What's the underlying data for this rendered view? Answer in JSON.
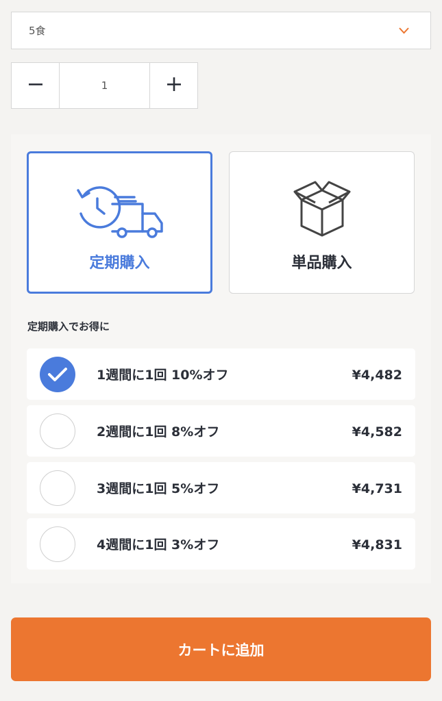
{
  "meal_select": {
    "value": "5食",
    "icon": "chevron-down-icon",
    "accent_color": "#ec7630"
  },
  "quantity": {
    "minus_icon": "minus-icon",
    "value": "1",
    "plus_icon": "plus-icon"
  },
  "purchase_types": [
    {
      "label": "定期購入",
      "icon": "clock-truck-icon",
      "selected": true
    },
    {
      "label": "単品購入",
      "icon": "box-icon",
      "selected": false
    }
  ],
  "plans_heading": "定期購入でお得に",
  "plans": [
    {
      "label": "1週間に1回 10%オフ",
      "price": "¥4,482",
      "selected": true
    },
    {
      "label": "2週間に1回 8%オフ",
      "price": "¥4,582",
      "selected": false
    },
    {
      "label": "3週間に1回 5%オフ",
      "price": "¥4,731",
      "selected": false
    },
    {
      "label": "4週間に1回 3%オフ",
      "price": "¥4,831",
      "selected": false
    }
  ],
  "cart_button": "カートに追加",
  "colors": {
    "accent_blue": "#4a7bdc",
    "cart_orange": "#ec7630"
  }
}
